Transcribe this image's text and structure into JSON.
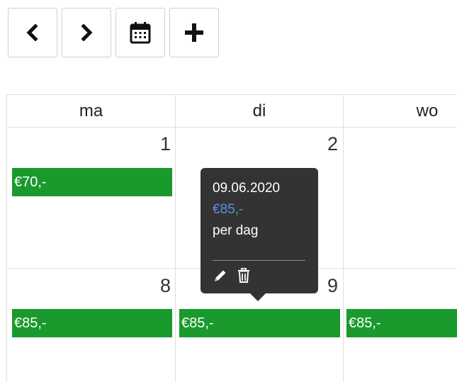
{
  "toolbar": {
    "prev_icon": "chevron-left-icon",
    "next_icon": "chevron-right-icon",
    "calendar_icon": "calendar-icon",
    "add_icon": "plus-icon"
  },
  "calendar": {
    "weekdays": [
      "ma",
      "di",
      "wo"
    ],
    "weeks": [
      {
        "dates": [
          "1",
          "2",
          ""
        ],
        "prices": [
          "€70,-",
          "",
          ""
        ]
      },
      {
        "dates": [
          "8",
          "9",
          ""
        ],
        "prices": [
          "€85,-",
          "€85,-",
          "€85,-"
        ]
      }
    ],
    "event_color": "#1a9a2c"
  },
  "tooltip": {
    "date": "09.06.2020",
    "price": "€85,-",
    "unit": "per dag",
    "price_color": "#5b8fe6",
    "background": "#333333",
    "edit_icon": "pencil-icon",
    "delete_icon": "trash-icon"
  }
}
